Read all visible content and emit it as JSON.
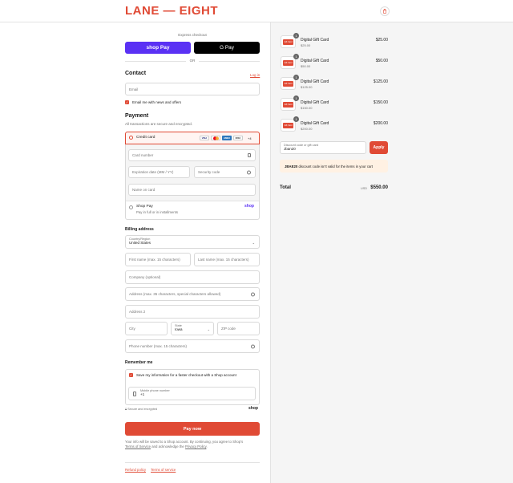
{
  "brand": {
    "logo": "LANE — EIGHT",
    "accent": "#e04a35"
  },
  "express": {
    "title": "Express checkout",
    "shop_pay": "shop Pay",
    "gpay": "G Pay",
    "or": "OR"
  },
  "contact": {
    "title": "Contact",
    "login": "Log in",
    "email_placeholder": "Email",
    "news_checkbox": "Email me with news and offers"
  },
  "payment": {
    "title": "Payment",
    "subtitle": "All transactions are secure and encrypted.",
    "credit_card_label": "Credit card",
    "card_brands": [
      "VISA",
      "MC",
      "AMEX",
      "DISC"
    ],
    "more_cards": "+4",
    "card_number": "Card number",
    "expiry": "Expiration date (MM / YY)",
    "security_code": "Security code",
    "name_on_card": "Name on card",
    "shop_pay_label": "Shop Pay",
    "shop_pay_sub": "Pay in full or in installments",
    "shop_pay_logo": "shop"
  },
  "billing": {
    "title": "Billing address",
    "country_label": "Country/Region",
    "country_value": "United States",
    "first_name": "First name (max. 15 characters)",
    "last_name": "Last name (max. 15 characters)",
    "company": "Company (optional)",
    "address": "Address (max. 35 characters, special characters allowed)",
    "address2": "Address 2",
    "city": "City",
    "state_label": "State",
    "state_value": "Iowa",
    "zip": "ZIP code",
    "phone": "Phone number (max. 15 characters)"
  },
  "remember": {
    "title": "Remember me",
    "save_checkbox": "Save my information for a faster checkout with a Shop account",
    "mobile_label": "Mobile phone number",
    "mobile_value": "+1",
    "secure_note": "Secure and encrypted",
    "shop_logo": "shop"
  },
  "pay_now": "Pay now",
  "legal": {
    "line1": "Your info will be saved to a Shop account. By continuing, you agree to Shop’s",
    "terms": "Terms of Service",
    "and": "and acknowledge the",
    "privacy": "Privacy Policy",
    "period": "."
  },
  "footer": {
    "refund": "Refund policy",
    "terms": "Terms of service"
  },
  "cart": {
    "items": [
      {
        "name": "Digital Gift Card",
        "variant": "$25.00",
        "price": "$25.00",
        "qty": "1"
      },
      {
        "name": "Digital Gift Card",
        "variant": "$50.00",
        "price": "$50.00",
        "qty": "1"
      },
      {
        "name": "Digital Gift Card",
        "variant": "$125.00",
        "price": "$125.00",
        "qty": "1"
      },
      {
        "name": "Digital Gift Card",
        "variant": "$150.00",
        "price": "$150.00",
        "qty": "1"
      },
      {
        "name": "Digital Gift Card",
        "variant": "$200.00",
        "price": "$200.00",
        "qty": "1"
      }
    ],
    "thumb_label": "Gift Card",
    "discount_label": "Discount code or gift card",
    "discount_value": "Jban20",
    "apply": "Apply",
    "error_code": "JBAE20",
    "error_text": "discount code isn't valid for the items in your cart",
    "total_label": "Total",
    "currency": "USD",
    "total": "$550.00"
  }
}
